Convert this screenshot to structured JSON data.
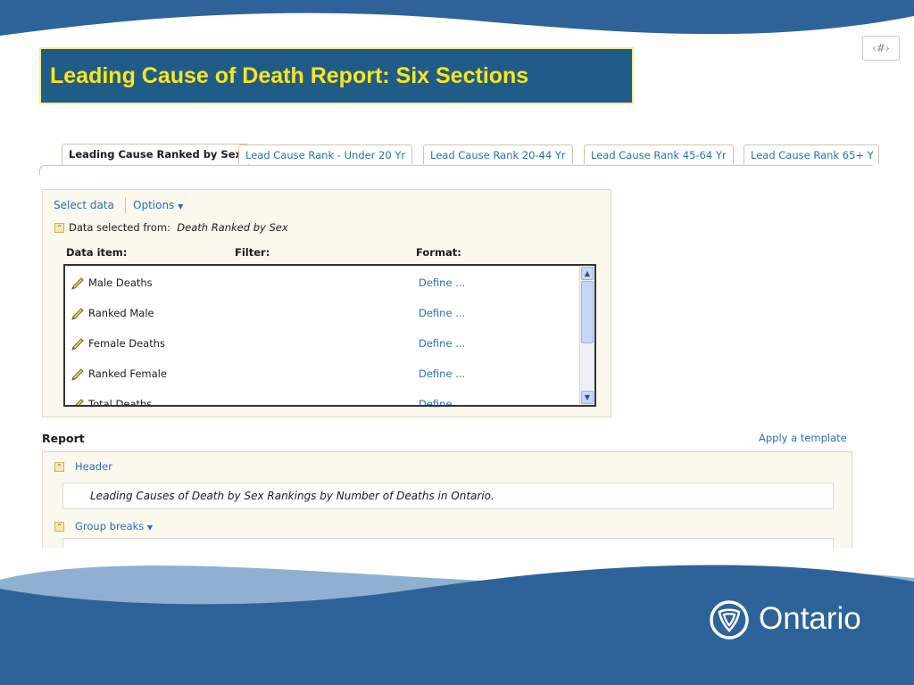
{
  "slide": {
    "number_placeholder": "‹#›",
    "title": "Leading Cause of Death Report: Six Sections",
    "colors": {
      "title_bg": "#1f5c88",
      "title_text": "#ffe61a",
      "wave_dark": "#2e639a",
      "wave_light": "#8fb0d0",
      "link": "#2a6fb3"
    }
  },
  "tabs": [
    {
      "label": "Leading Cause Ranked by Sex",
      "active": true
    },
    {
      "label": "Lead Cause Rank - Under 20 Yr",
      "active": false
    },
    {
      "label": "Lead Cause Rank 20-44 Yr",
      "active": false
    },
    {
      "label": "Lead Cause Rank 45-64 Yr",
      "active": false
    },
    {
      "label": "Lead Cause Rank 65+ Y",
      "active": false
    }
  ],
  "data_panel": {
    "select_data": "Select data",
    "options": "Options",
    "selected_from_label": "Data selected from:",
    "selected_from_value": "Death Ranked by Sex",
    "columns": [
      "Data item:",
      "Filter:",
      "Format:"
    ],
    "items": [
      {
        "name": "Male Deaths",
        "format": "Define ..."
      },
      {
        "name": "Ranked Male",
        "format": "Define ..."
      },
      {
        "name": "Female Deaths",
        "format": "Define ..."
      },
      {
        "name": "Ranked Female",
        "format": "Define ..."
      },
      {
        "name": "Total Deaths",
        "format": "Define ..."
      }
    ]
  },
  "report": {
    "label": "Report",
    "apply_template": "Apply a template",
    "header_link": "Header",
    "header_text": "Leading Causes of Death by Sex Rankings by Number of Deaths in Ontario.",
    "group_breaks": "Group breaks"
  },
  "brand": {
    "wordmark": "Ontario",
    "logo_icon": "ontario-trillium-logo"
  }
}
